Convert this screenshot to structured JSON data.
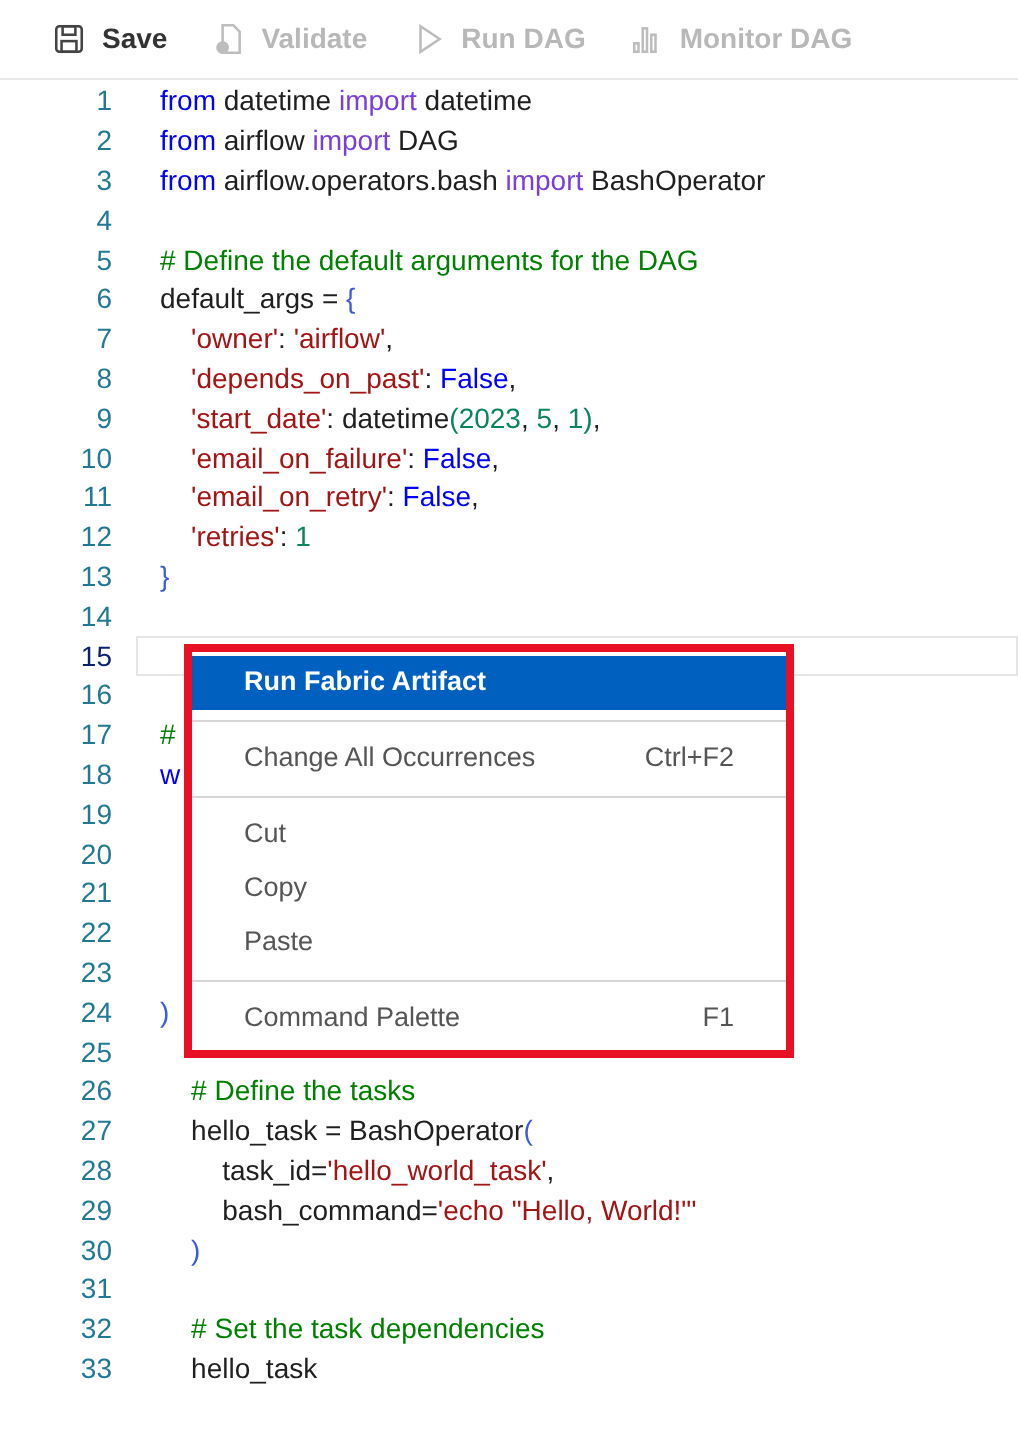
{
  "toolbar": [
    {
      "label": "Save",
      "disabled": false
    },
    {
      "label": "Validate",
      "disabled": true
    },
    {
      "label": "Run DAG",
      "disabled": true
    },
    {
      "label": "Monitor DAG",
      "disabled": true
    }
  ],
  "editor": {
    "lines": [
      {
        "number": "1",
        "current": false,
        "tokens": [
          {
            "t": "from",
            "kind": "keyword"
          },
          {
            "t": " datetime ",
            "kind": "plain"
          },
          {
            "t": "import",
            "kind": "control"
          },
          {
            "t": " datetime",
            "kind": "plain"
          }
        ]
      },
      {
        "number": "2",
        "current": false,
        "tokens": [
          {
            "t": "from",
            "kind": "keyword"
          },
          {
            "t": " airflow ",
            "kind": "plain"
          },
          {
            "t": "import",
            "kind": "control"
          },
          {
            "t": " DAG",
            "kind": "plain"
          }
        ]
      },
      {
        "number": "3",
        "current": false,
        "tokens": [
          {
            "t": "from",
            "kind": "keyword"
          },
          {
            "t": " airflow.operators.bash ",
            "kind": "plain"
          },
          {
            "t": "import",
            "kind": "control"
          },
          {
            "t": " BashOperator",
            "kind": "plain"
          }
        ]
      },
      {
        "number": "4",
        "current": false
      },
      {
        "number": "5",
        "current": false,
        "tokens": [
          {
            "t": "# Define the default arguments for the DAG",
            "kind": "comment"
          }
        ]
      },
      {
        "number": "6",
        "current": false,
        "tokens": [
          {
            "t": "default_args = ",
            "kind": "plain"
          },
          {
            "t": "{",
            "kind": "bracket"
          }
        ]
      },
      {
        "number": "7",
        "current": false,
        "tokens": [
          {
            "t": "    'owner'",
            "kind": "string"
          },
          {
            "t": ": ",
            "kind": "plain"
          },
          {
            "t": "'airflow'",
            "kind": "string"
          },
          {
            "t": ",",
            "kind": "plain"
          }
        ]
      },
      {
        "number": "8",
        "current": false,
        "tokens": [
          {
            "t": "    'depends_on_past'",
            "kind": "string"
          },
          {
            "t": ": ",
            "kind": "plain"
          },
          {
            "t": "False",
            "kind": "keyword"
          },
          {
            "t": ",",
            "kind": "plain"
          }
        ]
      },
      {
        "number": "9",
        "current": false,
        "tokens": [
          {
            "t": "    'start_date'",
            "kind": "string"
          },
          {
            "t": ": datetime",
            "kind": "plain"
          },
          {
            "t": "(",
            "kind": "number"
          },
          {
            "t": "2023",
            "kind": "number"
          },
          {
            "t": ", ",
            "kind": "plain"
          },
          {
            "t": "5",
            "kind": "number"
          },
          {
            "t": ", ",
            "kind": "plain"
          },
          {
            "t": "1",
            "kind": "number"
          },
          {
            "t": ")",
            "kind": "number"
          },
          {
            "t": ",",
            "kind": "plain"
          }
        ]
      },
      {
        "number": "10",
        "current": false,
        "tokens": [
          {
            "t": "    'email_on_failure'",
            "kind": "string"
          },
          {
            "t": ": ",
            "kind": "plain"
          },
          {
            "t": "False",
            "kind": "keyword"
          },
          {
            "t": ",",
            "kind": "plain"
          }
        ]
      },
      {
        "number": "11",
        "current": false,
        "tokens": [
          {
            "t": "    'email_on_retry'",
            "kind": "string"
          },
          {
            "t": ": ",
            "kind": "plain"
          },
          {
            "t": "False",
            "kind": "keyword"
          },
          {
            "t": ",",
            "kind": "plain"
          }
        ]
      },
      {
        "number": "12",
        "current": false,
        "tokens": [
          {
            "t": "    'retries'",
            "kind": "string"
          },
          {
            "t": ": ",
            "kind": "plain"
          },
          {
            "t": "1",
            "kind": "number"
          }
        ]
      },
      {
        "number": "13",
        "current": false,
        "tokens": [
          {
            "t": "}",
            "kind": "bracket"
          }
        ]
      },
      {
        "number": "14",
        "current": false
      },
      {
        "number": "15",
        "current": true
      },
      {
        "number": "16",
        "current": false
      },
      {
        "number": "17",
        "current": false,
        "tokens": [
          {
            "t": "#",
            "kind": "comment"
          }
        ]
      },
      {
        "number": "18",
        "current": false,
        "tokens": [
          {
            "t": "w",
            "kind": "keyword"
          }
        ]
      },
      {
        "number": "19",
        "current": false
      },
      {
        "number": "20",
        "current": false
      },
      {
        "number": "21",
        "current": false
      },
      {
        "number": "22",
        "current": false
      },
      {
        "number": "23",
        "current": false
      },
      {
        "number": "24",
        "current": false,
        "tokens": [
          {
            "t": ")",
            "kind": "bracket"
          }
        ]
      },
      {
        "number": "25",
        "current": false
      },
      {
        "number": "26",
        "current": false,
        "tokens": [
          {
            "t": "    # Define the tasks",
            "kind": "comment"
          }
        ]
      },
      {
        "number": "27",
        "current": false,
        "tokens": [
          {
            "t": "    hello_task = BashOperator",
            "kind": "plain"
          },
          {
            "t": "(",
            "kind": "bracket"
          }
        ]
      },
      {
        "number": "28",
        "current": false,
        "tokens": [
          {
            "t": "        task_id=",
            "kind": "plain"
          },
          {
            "t": "'hello_world_task'",
            "kind": "string"
          },
          {
            "t": ",",
            "kind": "plain"
          }
        ]
      },
      {
        "number": "29",
        "current": false,
        "tokens": [
          {
            "t": "        bash_command=",
            "kind": "plain"
          },
          {
            "t": "'echo \"Hello, World!\"'",
            "kind": "string"
          }
        ]
      },
      {
        "number": "30",
        "current": false,
        "tokens": [
          {
            "t": "    )",
            "kind": "bracket"
          }
        ]
      },
      {
        "number": "31",
        "current": false
      },
      {
        "number": "32",
        "current": false,
        "tokens": [
          {
            "t": "    # Set the task dependencies",
            "kind": "comment"
          }
        ]
      },
      {
        "number": "33",
        "current": false,
        "tokens": [
          {
            "t": "    hello_task",
            "kind": "plain"
          }
        ]
      }
    ]
  },
  "context_menu": {
    "outlined": true,
    "items": [
      {
        "kind": "item",
        "label": "Run Fabric Artifact",
        "selected": true
      },
      {
        "kind": "separator"
      },
      {
        "kind": "item",
        "label": "Change All Occurrences",
        "shortcut": "Ctrl+F2",
        "selected": false
      },
      {
        "kind": "separator"
      },
      {
        "kind": "item",
        "label": "Cut",
        "selected": false
      },
      {
        "kind": "item",
        "label": "Copy",
        "selected": false
      },
      {
        "kind": "item",
        "label": "Paste",
        "selected": false
      },
      {
        "kind": "separator"
      },
      {
        "kind": "item",
        "label": "Command Palette",
        "shortcut": "F1",
        "selected": false
      }
    ]
  }
}
